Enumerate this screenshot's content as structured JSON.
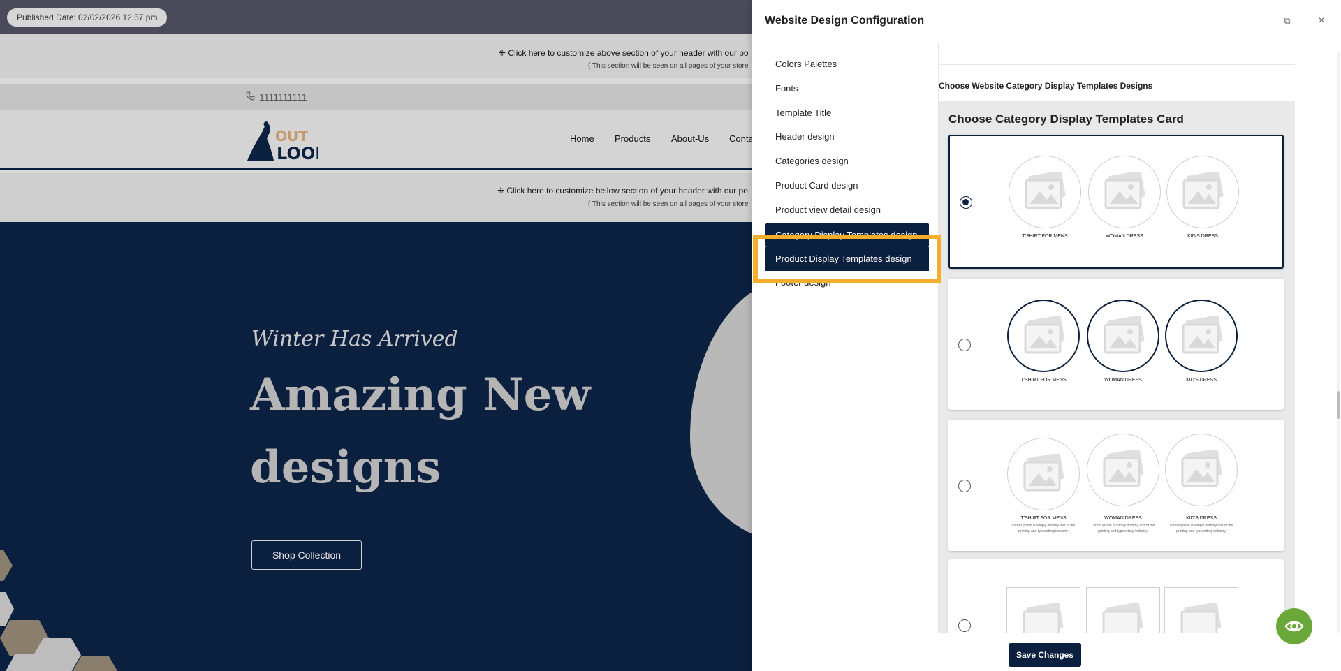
{
  "preview": {
    "published": "Published Date: 02/02/2026 12:57 pm",
    "above_header_cta": "⁜ Click here to customize above section of your header with our po",
    "above_header_note": "( This section will be seen on all pages of your store",
    "phone": "1111111111",
    "logo_text_top": "OUT",
    "logo_text_bottom": "LOOK",
    "nav": [
      "Home",
      "Products",
      "About-Us",
      "Conta"
    ],
    "below_header_cta": "⁜ Click here to customize bellow section of your header with our po",
    "below_header_note": "( This section will be seen on all pages of your store",
    "hero_script": "Winter Has Arrived",
    "hero_line1": "Amazing New",
    "hero_line2": "designs",
    "hero_button": "Shop Collection"
  },
  "drawer": {
    "title": "Website Design Configuration",
    "menu": [
      "Colors Palettes",
      "Fonts",
      "Template Title",
      "Header design",
      "Categories design",
      "Product Card design",
      "Product view detail design",
      "Category Display Templates design",
      "Product Display Templates design",
      "Footer design"
    ],
    "active_overlay": "Product Display Templates design",
    "section_title": "Choose Website Category Display Templates Designs",
    "panel_title": "Choose Category Display Templates Card",
    "categories": [
      "T'SHIRT FOR MENS",
      "WOMAN DRESS",
      "KID'S DRESS"
    ],
    "category_desc": "Lorem ipsum is simply dummy text of the printing and typesetting industry.",
    "save_button": "Save Changes"
  },
  "colors": {
    "navy": "#0b1f3f",
    "highlight": "#f5ad2a",
    "fab_green": "#6aa83a"
  }
}
